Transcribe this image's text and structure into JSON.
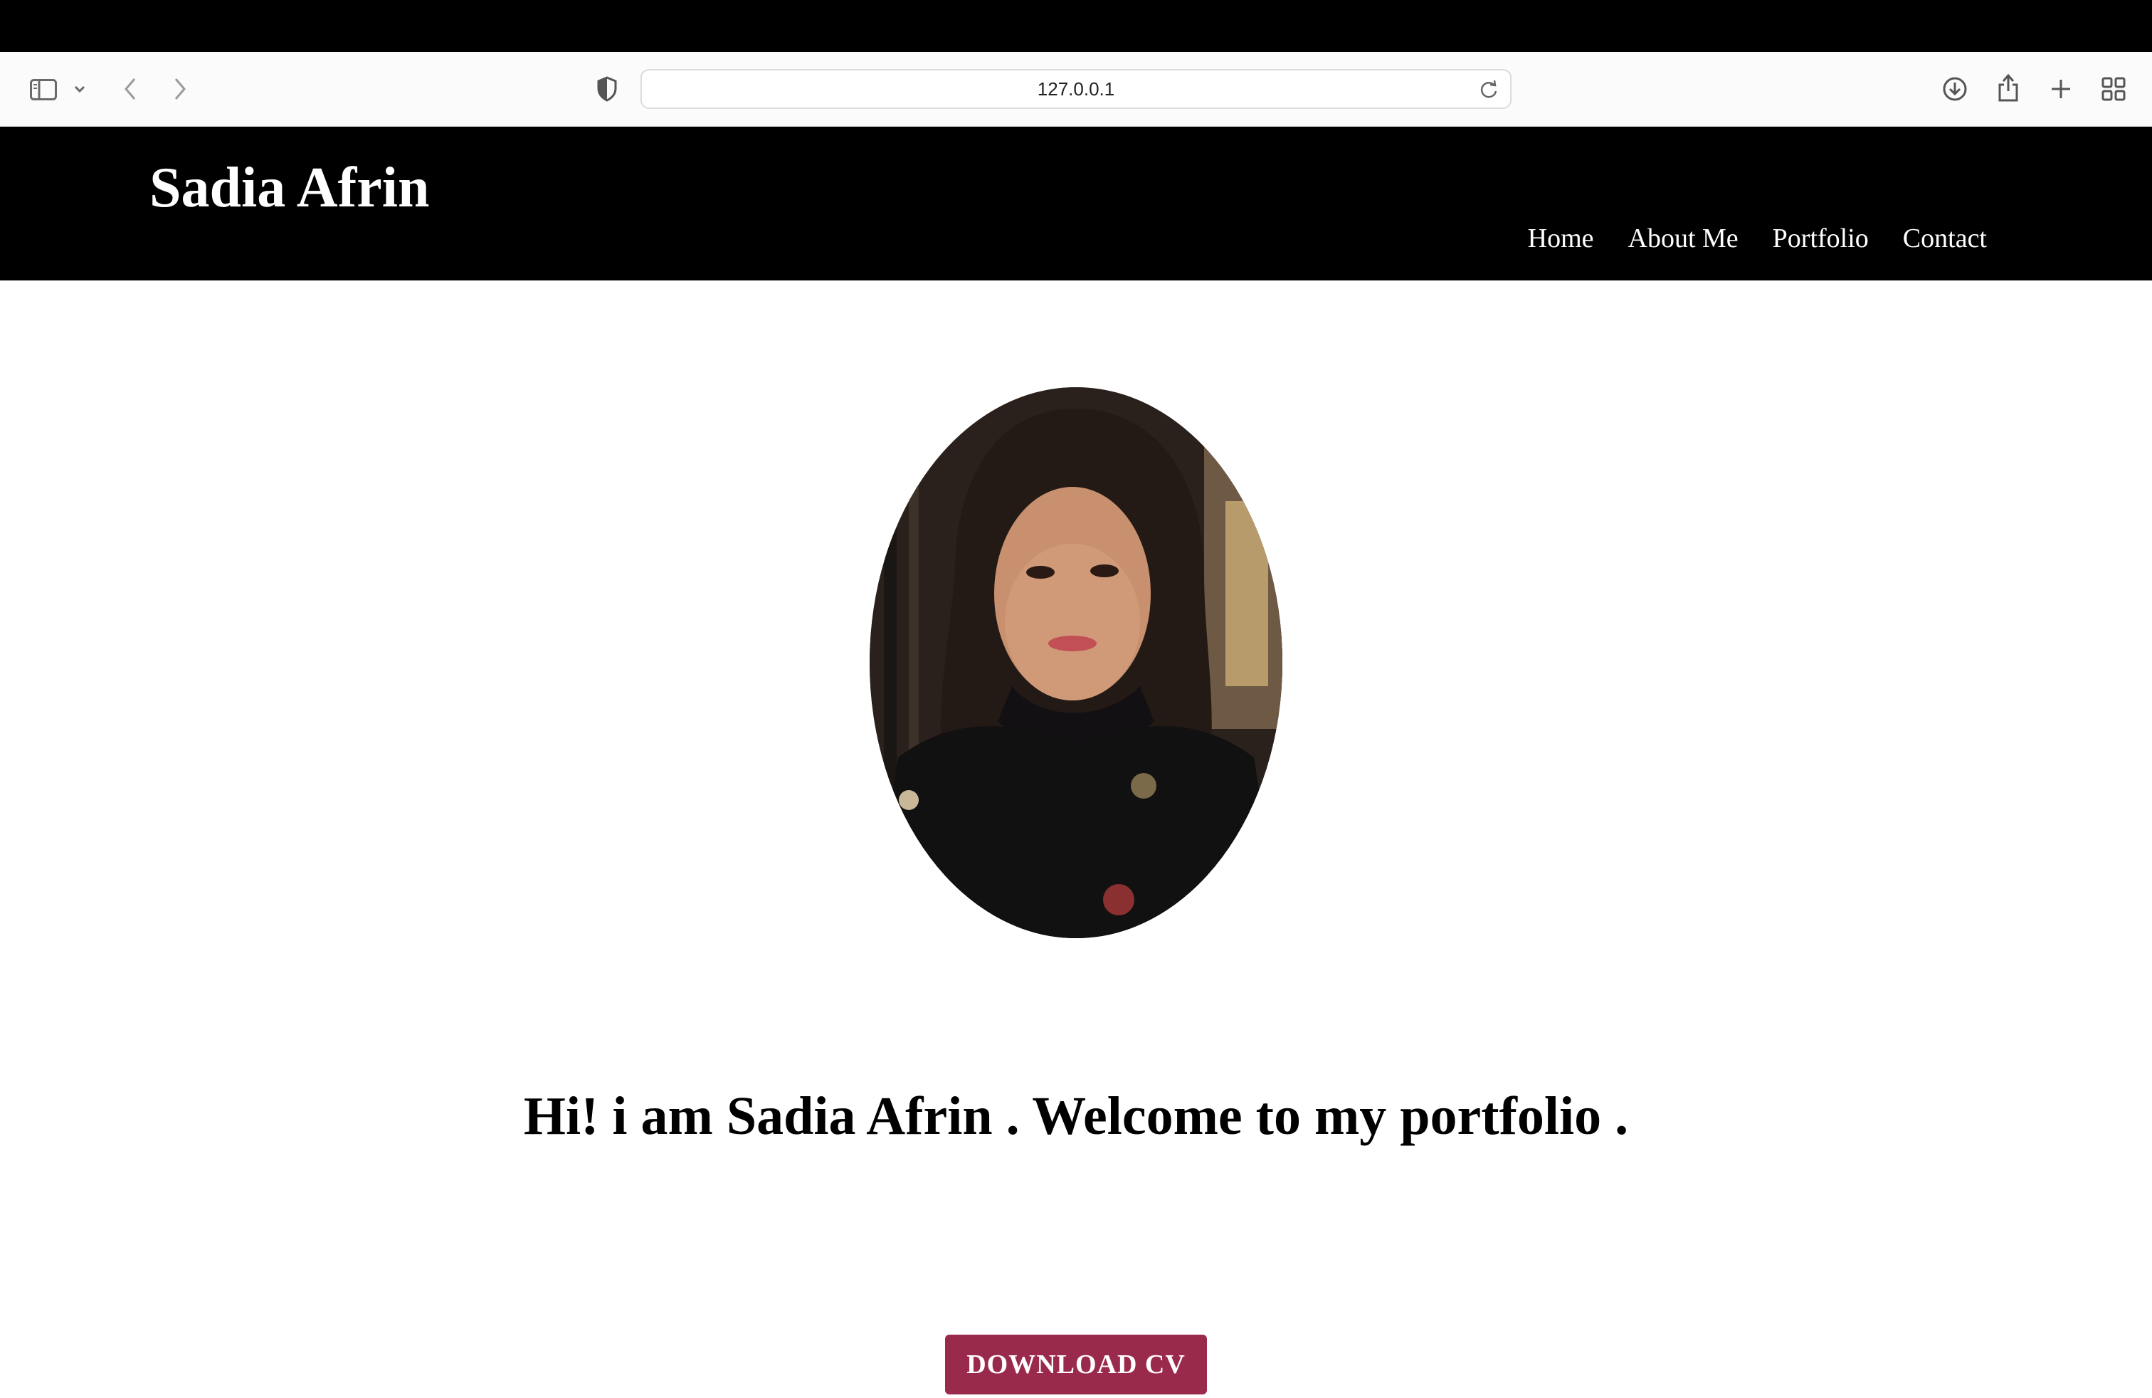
{
  "browser": {
    "url": "127.0.0.1",
    "icons": {
      "sidebar": "sidebar-icon",
      "sidebar_menu": "chevron-down-icon",
      "back": "back-icon",
      "forward": "forward-icon",
      "privacy": "shield-icon",
      "reload": "reload-icon",
      "downloads": "download-icon",
      "share": "share-icon",
      "new_tab": "plus-icon",
      "tab_overview": "tabs-grid-icon"
    }
  },
  "header": {
    "title": "Sadia Afrin",
    "nav": [
      "Home",
      "About Me",
      "Portfolio",
      "Contact"
    ]
  },
  "hero": {
    "welcome": "Hi! i am Sadia Afrin . Welcome to my portfolio .",
    "button": "DOWNLOAD CV"
  },
  "colors": {
    "header_bg": "#000000",
    "button_bg": "#9a2a4c",
    "page_bg": "#ffffff"
  }
}
